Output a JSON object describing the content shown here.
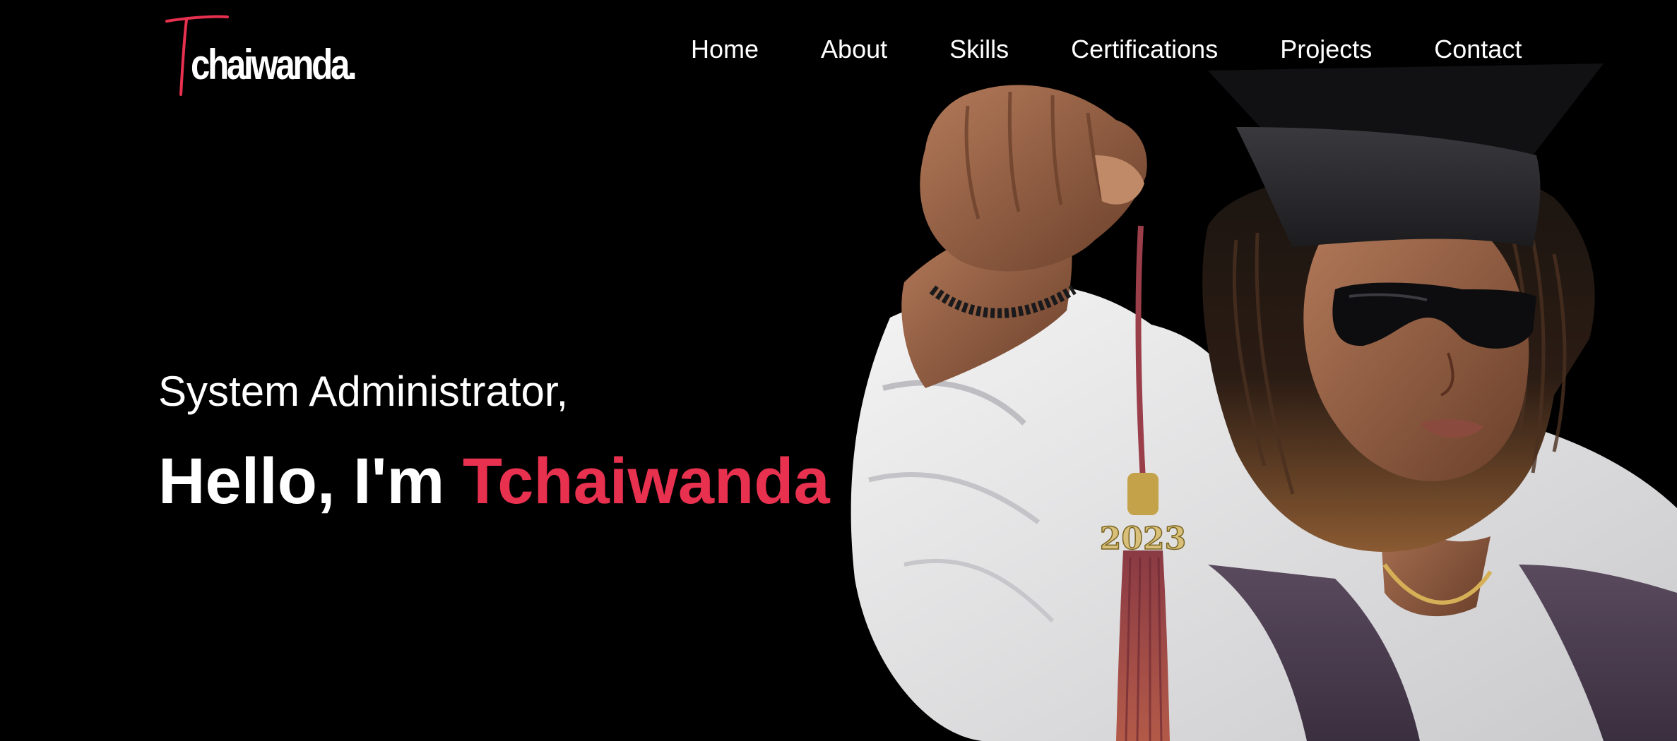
{
  "brand": {
    "logo_text": "chaiwanda",
    "logo_dot": ".",
    "accent_color": "#e8304f"
  },
  "nav": {
    "items": [
      "Home",
      "About",
      "Skills",
      "Certifications",
      "Projects",
      "Contact"
    ]
  },
  "hero": {
    "subtitle": "System Administrator,",
    "greeting": "Hello, I'm ",
    "name": "Tchaiwanda",
    "photo_tassel_year": "2023"
  },
  "colors": {
    "background": "#000000",
    "text": "#ffffff",
    "accent": "#e8304f"
  }
}
